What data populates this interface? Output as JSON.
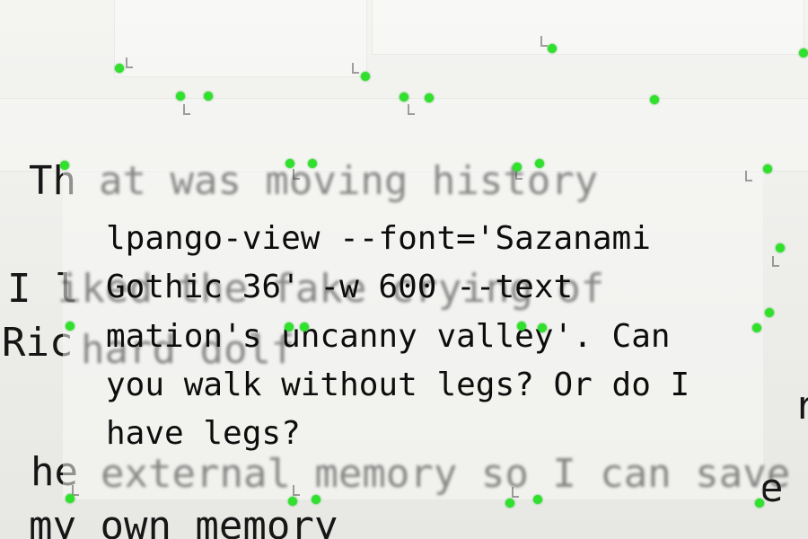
{
  "photo": {
    "background_lines": [
      "Th",
      "I l",
      "Ric",
      "he",
      "my own memory",
      "e",
      "r"
    ],
    "blurred_lines": [
      "at was moving history",
      "iked the fake crying of",
      "hard dolf",
      "external memory so I can save"
    ],
    "focused_text": [
      "lpango-view --font='Sazanami",
      "Gothic 36' -w 600 --text",
      "mation's uncanny valley'.  Can",
      "you walk without legs? Or do I",
      "have legs?"
    ]
  },
  "colors": {
    "marker": "#2fe02c",
    "ink": "#0d0d0d"
  }
}
